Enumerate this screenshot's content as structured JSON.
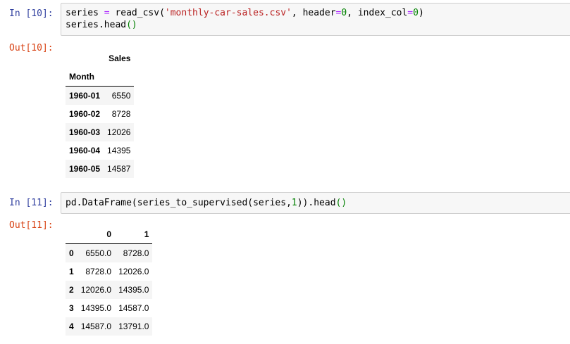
{
  "cells": [
    {
      "in_prompt": "In [10]:",
      "code_lines": [
        [
          {
            "t": "series ",
            "c": ""
          },
          {
            "t": "=",
            "c": "op"
          },
          {
            "t": " read_csv(",
            "c": ""
          },
          {
            "t": "'monthly-car-sales.csv'",
            "c": "str"
          },
          {
            "t": ", header",
            "c": ""
          },
          {
            "t": "=",
            "c": "op"
          },
          {
            "t": "0",
            "c": "num"
          },
          {
            "t": ", index_col",
            "c": ""
          },
          {
            "t": "=",
            "c": "op"
          },
          {
            "t": "0",
            "c": "num"
          },
          {
            "t": ")",
            "c": ""
          }
        ],
        [
          {
            "t": "series.head",
            "c": ""
          },
          {
            "t": "()",
            "c": "par"
          }
        ]
      ],
      "out_prompt": "Out[10]:",
      "table": {
        "column_header": "Sales",
        "index_name": "Month",
        "rows": [
          {
            "index": "1960-01",
            "value": "6550"
          },
          {
            "index": "1960-02",
            "value": "8728"
          },
          {
            "index": "1960-03",
            "value": "12026"
          },
          {
            "index": "1960-04",
            "value": "14395"
          },
          {
            "index": "1960-05",
            "value": "14587"
          }
        ]
      }
    },
    {
      "in_prompt": "In [11]:",
      "code_lines": [
        [
          {
            "t": "pd.DataFrame(series_to_supervised(series,",
            "c": ""
          },
          {
            "t": "1",
            "c": "num"
          },
          {
            "t": ")).head",
            "c": ""
          },
          {
            "t": "()",
            "c": "par"
          }
        ]
      ],
      "out_prompt": "Out[11]:",
      "table": {
        "columns": [
          "0",
          "1"
        ],
        "rows": [
          {
            "index": "0",
            "values": [
              "6550.0",
              "8728.0"
            ]
          },
          {
            "index": "1",
            "values": [
              "8728.0",
              "12026.0"
            ]
          },
          {
            "index": "2",
            "values": [
              "12026.0",
              "14395.0"
            ]
          },
          {
            "index": "3",
            "values": [
              "14395.0",
              "14587.0"
            ]
          },
          {
            "index": "4",
            "values": [
              "14587.0",
              "13791.0"
            ]
          }
        ]
      }
    }
  ],
  "colors": {
    "in_prompt": "#303f9f",
    "out_prompt": "#d84315",
    "string": "#ba2121",
    "number": "#008000",
    "operator": "#aa22ff",
    "input_bg": "#f7f7f7",
    "input_border": "#cfcfcf",
    "row_stripe": "#f5f5f5"
  }
}
